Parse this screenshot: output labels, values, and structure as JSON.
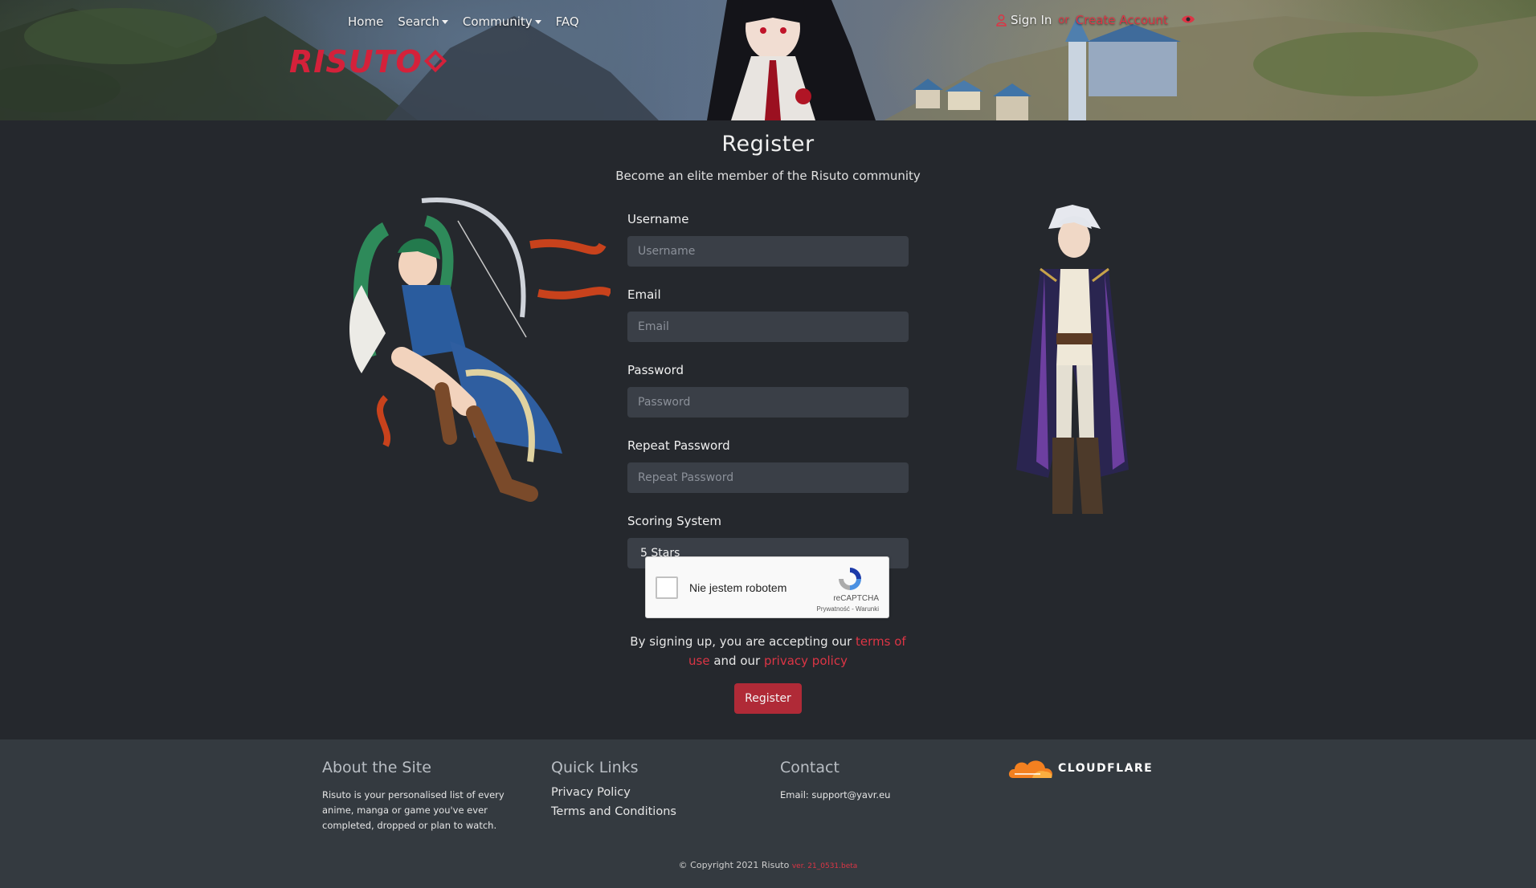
{
  "nav": {
    "items": [
      {
        "label": "Home"
      },
      {
        "label": "Search",
        "dropdown": true
      },
      {
        "label": "Community",
        "dropdown": true
      },
      {
        "label": "FAQ"
      }
    ],
    "logo_text": "RISUTO"
  },
  "auth": {
    "signin": "Sign In",
    "separator": "or",
    "create": "Create Account"
  },
  "page": {
    "title": "Register",
    "subtitle": "Become an elite member of the Risuto community"
  },
  "form": {
    "username": {
      "label": "Username",
      "placeholder": "Username"
    },
    "email": {
      "label": "Email",
      "placeholder": "Email"
    },
    "password": {
      "label": "Password",
      "placeholder": "Password"
    },
    "repeat_password": {
      "label": "Repeat Password",
      "placeholder": "Repeat Password"
    },
    "scoring": {
      "label": "Scoring System",
      "value": "5 Stars"
    }
  },
  "captcha": {
    "label": "Nie jestem robotem",
    "brand": "reCAPTCHA",
    "links": "Prywatność - Warunki"
  },
  "terms": {
    "prefix": "By signing up, you are accepting our",
    "terms_link": "terms of use",
    "middle": "and our",
    "privacy_link": "privacy policy"
  },
  "register_button": "Register",
  "footer": {
    "about": {
      "heading": "About the Site",
      "text": "Risuto is your personalised list of every anime, manga or game you've ever completed, dropped or plan to watch."
    },
    "quick_links": {
      "heading": "Quick Links",
      "links": [
        "Privacy Policy",
        "Terms and Conditions"
      ]
    },
    "contact": {
      "heading": "Contact",
      "email": "Email: support@yavr.eu"
    },
    "cloudflare": "CLOUDFLARE",
    "copyright": "© Copyright 2021 Risuto",
    "version": "ver. 21_0531.beta"
  },
  "colors": {
    "accent": "#dc3545",
    "button": "#b02a37",
    "background": "#25282d",
    "footer": "#343a40",
    "input": "#3a3f47"
  }
}
